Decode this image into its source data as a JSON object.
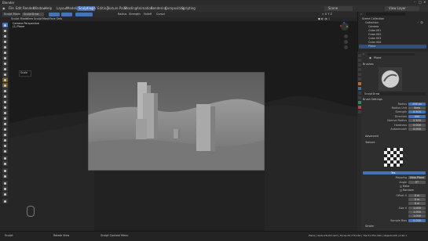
{
  "window": {
    "title": "Blender"
  },
  "menubar": {
    "menus": [
      "File",
      "Edit",
      "Render",
      "Window",
      "Help"
    ],
    "tabs": [
      "Layout",
      "Modeling",
      "Sculpting",
      "UV Editing",
      "Texture Paint",
      "Shading",
      "Animation",
      "Rendering",
      "Compositing",
      "Scripting"
    ],
    "active_tab": "Sculpting",
    "scene": "Scene",
    "view_layer": "View Layer"
  },
  "header": {
    "mode": "Sculpt Mode",
    "menus": [
      "View",
      "Sculpt",
      "Mask",
      "Face Sets"
    ],
    "brush_name": "SculptDraw",
    "radius_label": "Radius",
    "strength_label": "Strength",
    "falloff_label": "Falloff",
    "cursor_label": "Cursor"
  },
  "viewport": {
    "camera_label": "Camera Perspective",
    "object_label": "(1) Plane"
  },
  "tooltip": {
    "text": "Scale"
  },
  "outliner": {
    "title": "Scene Collection",
    "items": [
      "Collection",
      "Camera",
      "Cube.001",
      "Cube.002",
      "Cube.003",
      "Cube.004",
      "Plane"
    ]
  },
  "properties": {
    "object_name": "Plane",
    "brushes_header": "Brushes",
    "brush_name": "SculptDraw",
    "brush_settings_header": "Brush Settings",
    "settings": [
      {
        "label": "Radius",
        "value": "256 px"
      },
      {
        "label": "Radius Unit",
        "value": "View"
      },
      {
        "label": "Strength",
        "value": "0.500"
      },
      {
        "label": "Direction",
        "value": "Add"
      },
      {
        "label": "Normal Radius",
        "value": "0.500"
      },
      {
        "label": "Hardness",
        "value": "0.000"
      },
      {
        "label": "Autosmooth",
        "value": "0.000"
      }
    ],
    "advanced": "Advanced",
    "texture": "Texture",
    "texture_name": "Tex",
    "mapping_label": "Mapping",
    "mapping_value": "View Plane",
    "angle_label": "Angle",
    "angle_value": "0°",
    "rake": "Rake",
    "random": "Random",
    "offset_label": "Offset X",
    "offset_values": [
      "0 m",
      "0 m",
      "0 m"
    ],
    "size_label": "Size X",
    "size_values": [
      "1.000",
      "1.000",
      "1.000"
    ],
    "sample_bias_label": "Sample Bias",
    "sample_bias_value": "0.000",
    "stroke": "Stroke"
  },
  "statusbar": {
    "items": [
      "Sculpt",
      "Rotate View",
      "Sculpt Context Menu"
    ],
    "stats": "Plane | Verts:26,017,923 | Faces:25,776,150 | Tris:51,552,300 | Objects:0/6 | 2.90.1"
  },
  "colors": {
    "accent": "#4772b3",
    "panel": "#2e2e2e",
    "viewport_bg": "#1b1b1b",
    "render_sky": "#6c6c6c"
  }
}
